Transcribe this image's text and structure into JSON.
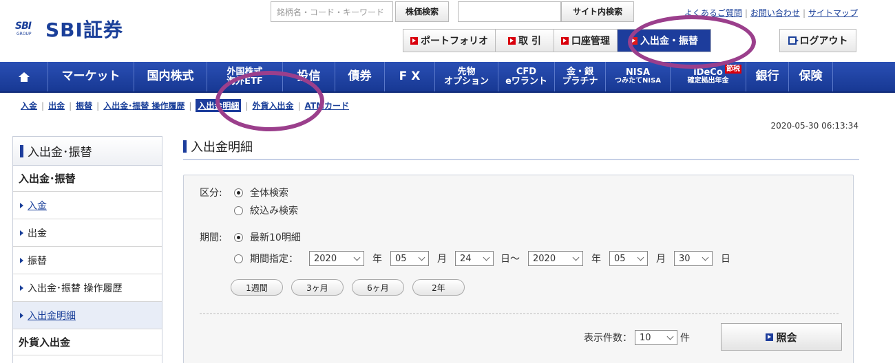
{
  "brand": {
    "mark": "SBI",
    "group": "GROUP",
    "name": "SBI証券"
  },
  "search": {
    "stock_placeholder": "銘柄名・コード・キーワード",
    "stock_button": "株価検索",
    "site_placeholder": "",
    "site_button": "サイト内検索"
  },
  "toplinks": {
    "faq": "よくあるご質問",
    "contact": "お問い合わせ",
    "sitemap": "サイトマップ"
  },
  "mainnav": {
    "portfolio": "ポートフォリオ",
    "trade": "取 引",
    "account": "口座管理",
    "deposit": "入出金・振替",
    "logout": "ログアウト"
  },
  "bluenav": {
    "market": "マーケット",
    "domestic": "国内株式",
    "foreign_1": "外国株式",
    "foreign_2": "海外ETF",
    "fund": "投信",
    "bond": "債券",
    "fx": "F X",
    "futures_1": "先物",
    "futures_2": "オプション",
    "cfd_1": "CFD",
    "cfd_2": "eワラント",
    "gold_1": "金・銀",
    "gold_2": "プラチナ",
    "nisa_1": "NISA",
    "nisa_2": "つみたてNISA",
    "ideco_1": "iDeCo",
    "ideco_badge": "節税",
    "ideco_2": "確定拠出年金",
    "bank": "銀行",
    "insurance": "保険"
  },
  "subnav": [
    "入金",
    "出金",
    "振替",
    "入出金･振替 操作履歴",
    "入出金明細",
    "外貨入出金",
    "ATMカード"
  ],
  "timestamp": "2020-05-30 06:13:34",
  "sidebar": {
    "title": "入出金･振替",
    "section1": "入出金･振替",
    "items": [
      "入金",
      "出金",
      "振替",
      "入出金･振替 操作履歴",
      "入出金明細"
    ],
    "section2": "外貨入出金"
  },
  "page": {
    "title": "入出金明細"
  },
  "form": {
    "category_label": "区分:",
    "opt_all": "全体検索",
    "opt_narrow": "絞込み検索",
    "period_label": "期間:",
    "opt_latest": "最新10明細",
    "opt_range": "期間指定：",
    "from_year": "2020",
    "from_month": "05",
    "from_day": "24",
    "to_year": "2020",
    "to_month": "05",
    "to_day": "30",
    "unit_year": "年",
    "unit_month": "月",
    "unit_day_from": "日～",
    "unit_day": "日",
    "quick": [
      "1週間",
      "3ヶ月",
      "6ヶ月",
      "2年"
    ],
    "count_label": "表示件数：",
    "count_value": "10",
    "count_unit": "件",
    "submit": "照会"
  }
}
